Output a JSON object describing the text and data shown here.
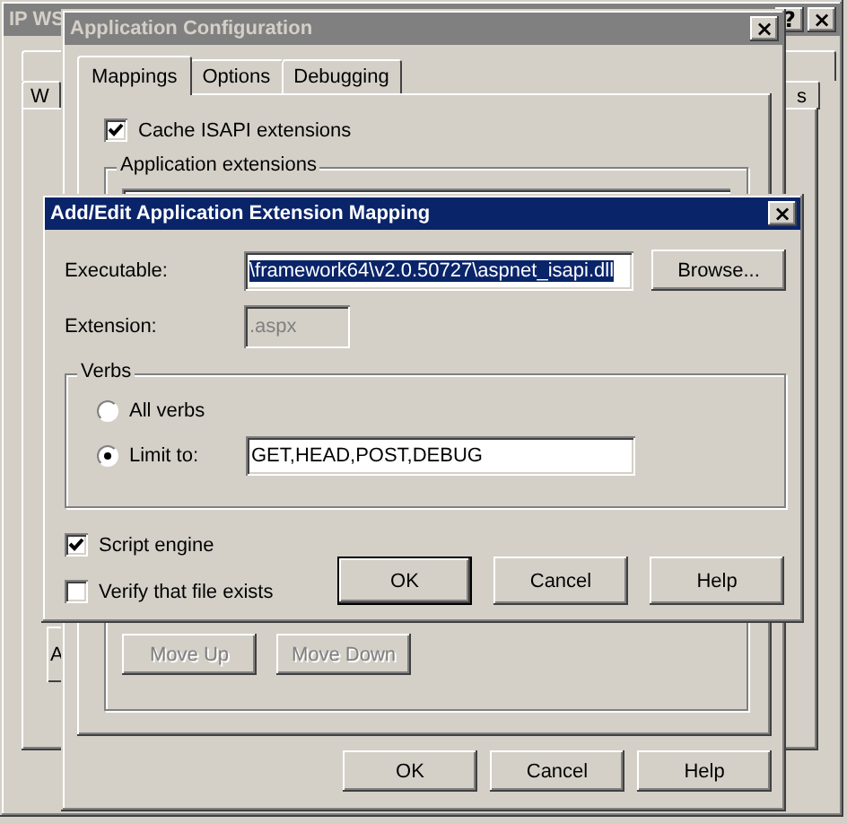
{
  "background_window": {
    "title": "IP WS",
    "active": false,
    "help_button": "?",
    "close_button": "×",
    "tabs": [
      {
        "label": "W"
      },
      {
        "label": "s"
      }
    ],
    "button_fragment": "A"
  },
  "config_window": {
    "title": "Application Configuration",
    "active": false,
    "close_button": "×",
    "tabs": [
      {
        "label": "Mappings",
        "selected": true
      },
      {
        "label": "Options",
        "selected": false
      },
      {
        "label": "Debugging",
        "selected": false
      }
    ],
    "cache_isapi": {
      "label": "Cache ISAPI extensions",
      "checked": true
    },
    "extensions_group": {
      "title": "Application extensions"
    },
    "move_buttons": [
      {
        "label": "Move Up",
        "disabled": true
      },
      {
        "label": "Move Down",
        "disabled": true
      }
    ],
    "buttons": [
      {
        "label": "OK"
      },
      {
        "label": "Cancel"
      },
      {
        "label": "Help"
      }
    ]
  },
  "mapping_dialog": {
    "title": "Add/Edit Application Extension Mapping",
    "active": true,
    "close_button": "×",
    "executable": {
      "label": "Executable:",
      "value": "\\framework64\\v2.0.50727\\aspnet_isapi.dll",
      "selected_text": true
    },
    "browse_button": "Browse...",
    "extension": {
      "label": "Extension:",
      "value": ".aspx",
      "disabled": true
    },
    "verbs": {
      "title": "Verbs",
      "options": [
        {
          "label": "All verbs",
          "selected": false
        },
        {
          "label": "Limit to:",
          "selected": true
        }
      ],
      "limit_value": "GET,HEAD,POST,DEBUG"
    },
    "checks": [
      {
        "label": "Script engine",
        "checked": true
      },
      {
        "label": "Verify that file exists",
        "checked": false
      }
    ],
    "buttons": [
      {
        "label": "OK",
        "default": true
      },
      {
        "label": "Cancel",
        "default": false
      },
      {
        "label": "Help",
        "default": false
      }
    ]
  }
}
